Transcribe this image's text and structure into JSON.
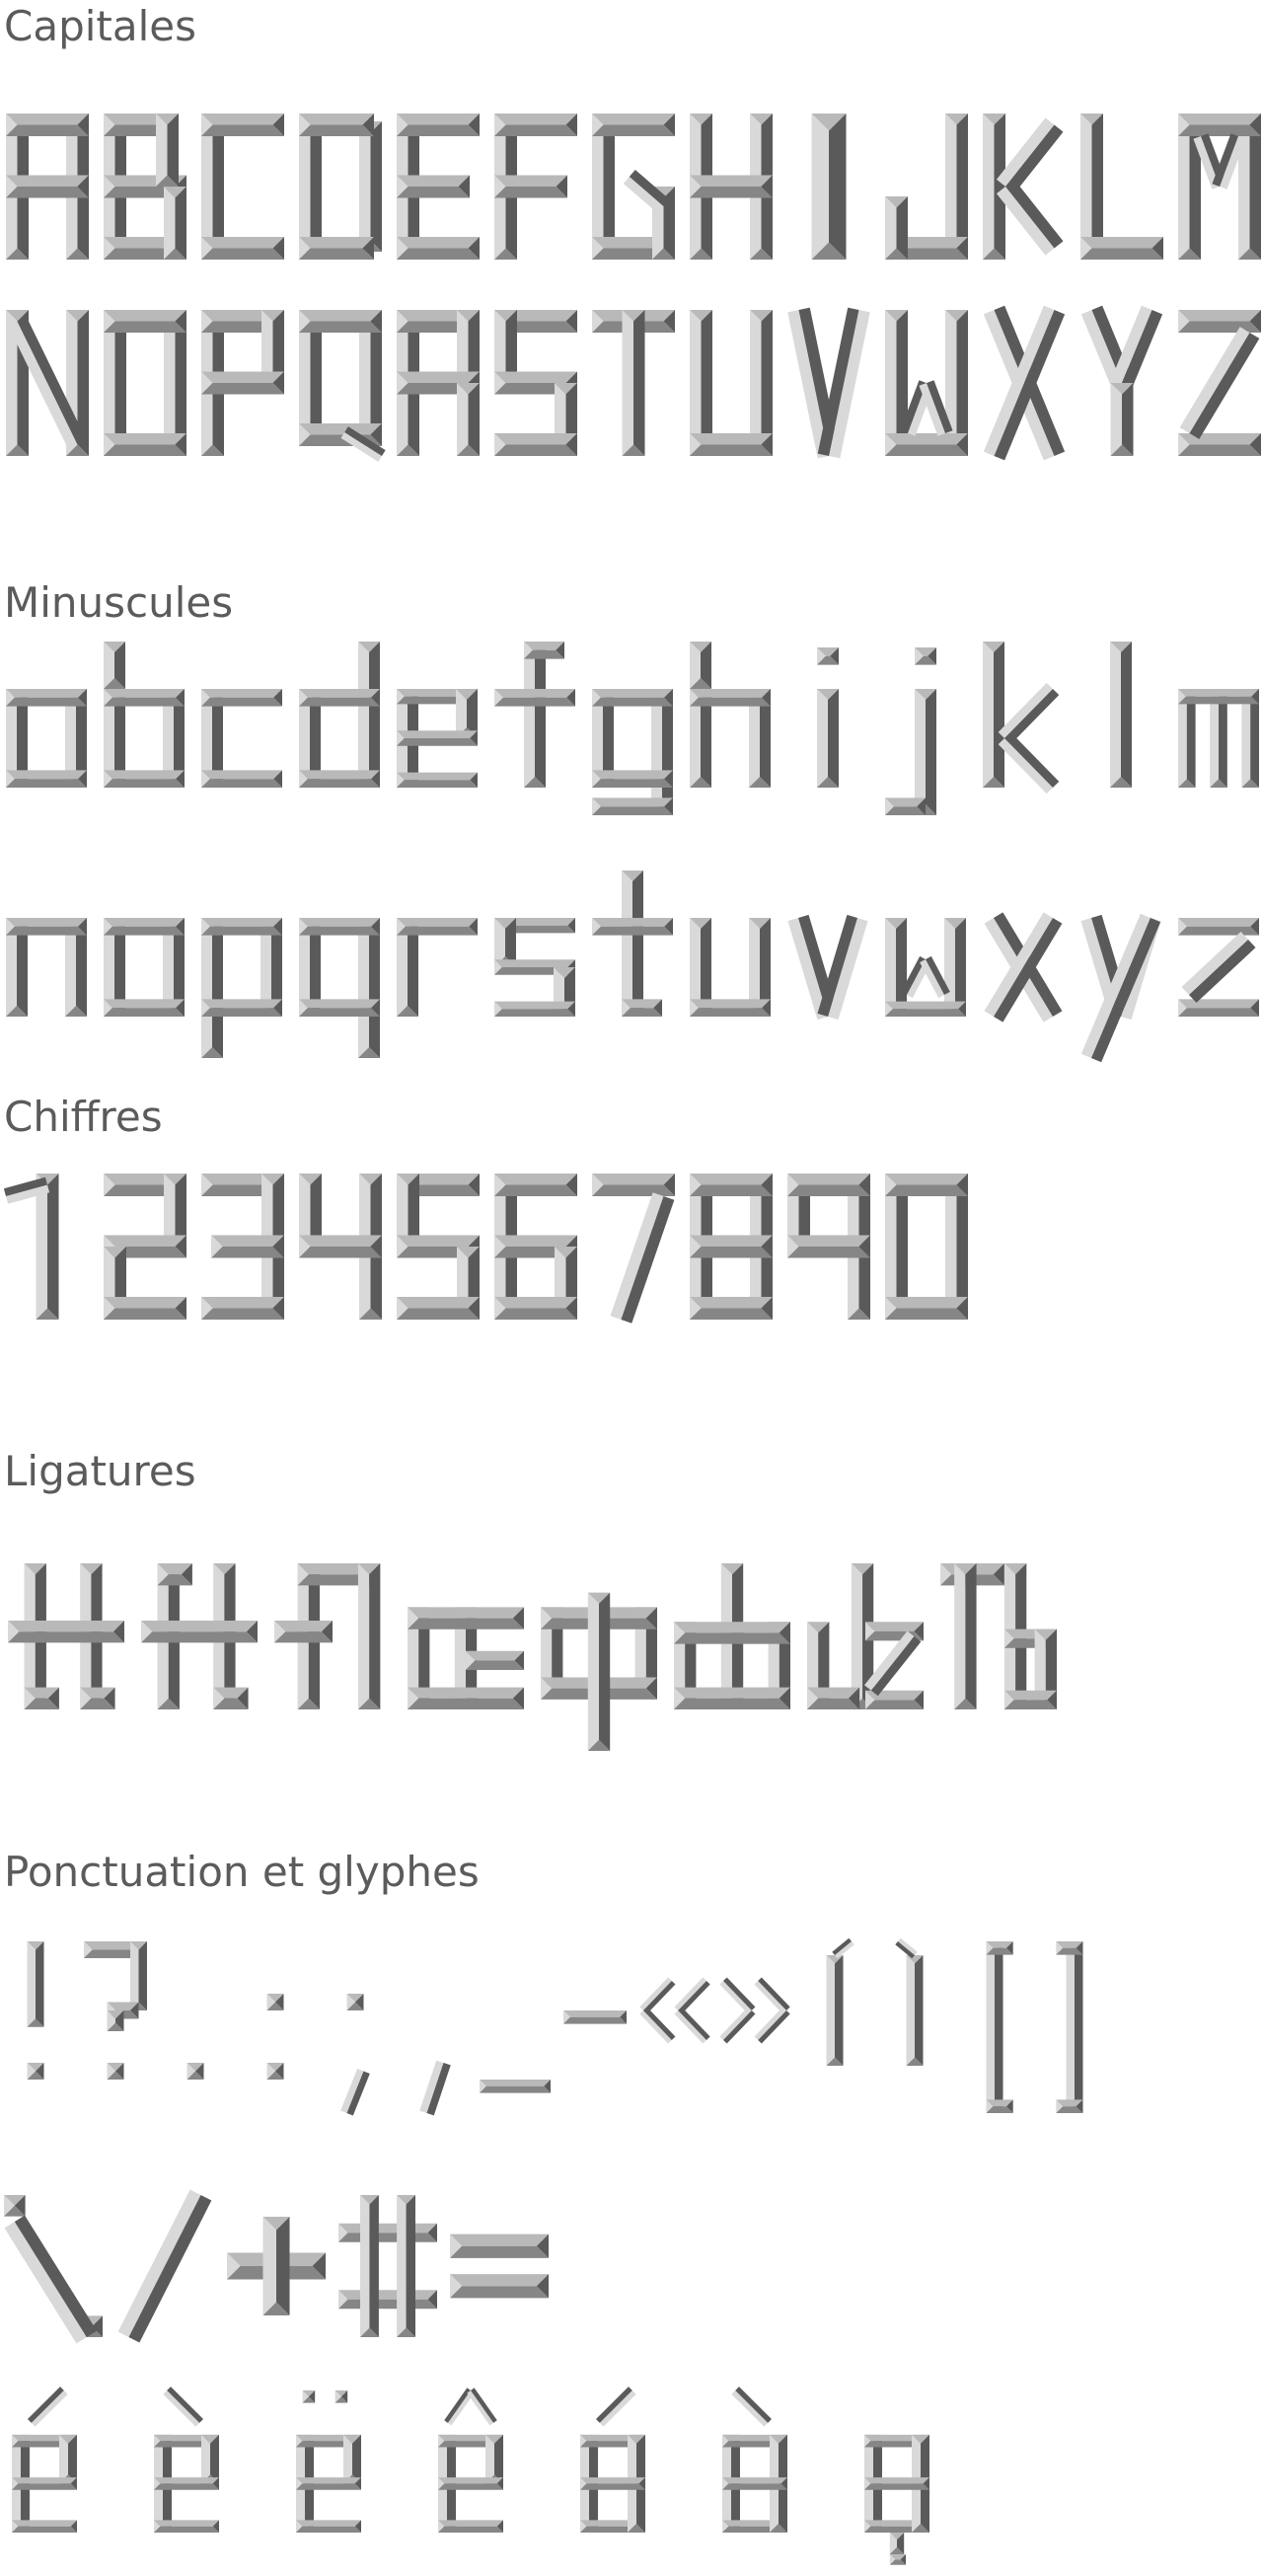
{
  "colors": {
    "background": "#ffffff",
    "title_text": "#5b5b5b",
    "glyph_base": "#9b9b9b",
    "glyph_light": "#d9d9d9",
    "glyph_mid": "#b9b9b9",
    "glyph_mid_dark": "#868686",
    "glyph_dark": "#5a5a5a"
  },
  "sections": {
    "capitals": {
      "title": "Capitales",
      "rows": [
        [
          "A",
          "B",
          "C",
          "D",
          "E",
          "F",
          "G",
          "H",
          "I",
          "J",
          "K",
          "L",
          "M"
        ],
        [
          "N",
          "O",
          "P",
          "Q",
          "R",
          "S",
          "T",
          "U",
          "V",
          "W",
          "X",
          "Y",
          "Z"
        ]
      ]
    },
    "lowercase": {
      "title": "Minuscules",
      "rows": [
        [
          "a",
          "b",
          "c",
          "d",
          "e",
          "f",
          "g",
          "h",
          "i",
          "j",
          "k",
          "l",
          "m"
        ],
        [
          "n",
          "o",
          "p",
          "q",
          "r",
          "s",
          "t",
          "u",
          "v",
          "w",
          "x",
          "y",
          "z"
        ]
      ]
    },
    "digits": {
      "title": "Chiffres",
      "rows": [
        [
          "1",
          "2",
          "3",
          "4",
          "5",
          "6",
          "7",
          "8",
          "9",
          "0"
        ]
      ]
    },
    "ligatures": {
      "title": "Ligatures",
      "rows": [
        [
          "tt",
          "ft",
          "fl",
          "œ",
          "ɸ",
          "db",
          "dz",
          "Tb"
        ]
      ]
    },
    "punctuation": {
      "title": "Ponctuation et glyphes",
      "rows": [
        [
          "!",
          "?",
          ".",
          ":",
          ";",
          ",",
          "_",
          "-",
          "«",
          "»",
          "(",
          ")",
          "[",
          "]"
        ],
        [
          "%",
          "/",
          "+",
          "#",
          "="
        ],
        [
          "é",
          "è",
          "ë",
          "ê",
          "á",
          "à",
          "ç"
        ]
      ]
    }
  }
}
